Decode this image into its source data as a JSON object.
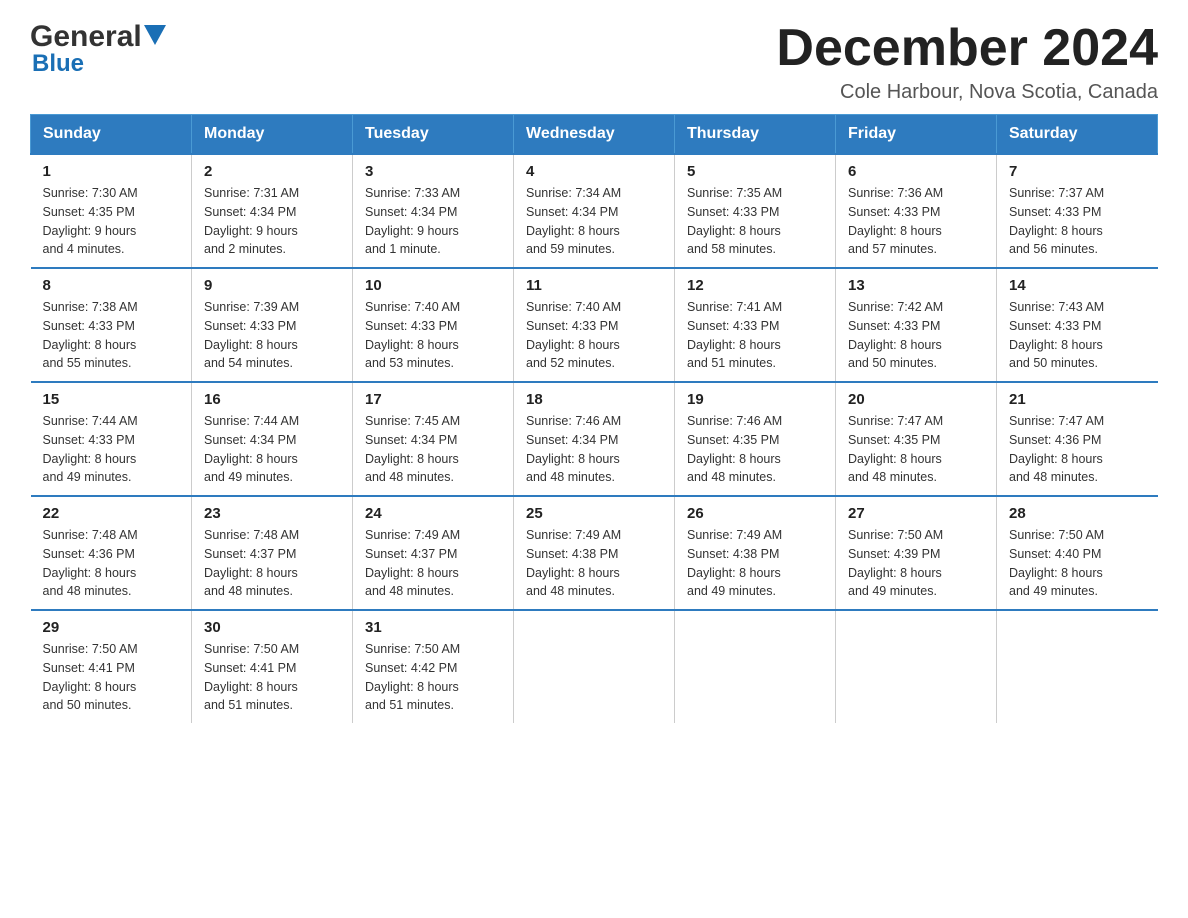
{
  "logo": {
    "general": "General",
    "blue": "Blue"
  },
  "title": {
    "month_year": "December 2024",
    "location": "Cole Harbour, Nova Scotia, Canada"
  },
  "days_of_week": [
    "Sunday",
    "Monday",
    "Tuesday",
    "Wednesday",
    "Thursday",
    "Friday",
    "Saturday"
  ],
  "weeks": [
    [
      {
        "day": "1",
        "sunrise": "7:30 AM",
        "sunset": "4:35 PM",
        "daylight": "9 hours and 4 minutes."
      },
      {
        "day": "2",
        "sunrise": "7:31 AM",
        "sunset": "4:34 PM",
        "daylight": "9 hours and 2 minutes."
      },
      {
        "day": "3",
        "sunrise": "7:33 AM",
        "sunset": "4:34 PM",
        "daylight": "9 hours and 1 minute."
      },
      {
        "day": "4",
        "sunrise": "7:34 AM",
        "sunset": "4:34 PM",
        "daylight": "8 hours and 59 minutes."
      },
      {
        "day": "5",
        "sunrise": "7:35 AM",
        "sunset": "4:33 PM",
        "daylight": "8 hours and 58 minutes."
      },
      {
        "day": "6",
        "sunrise": "7:36 AM",
        "sunset": "4:33 PM",
        "daylight": "8 hours and 57 minutes."
      },
      {
        "day": "7",
        "sunrise": "7:37 AM",
        "sunset": "4:33 PM",
        "daylight": "8 hours and 56 minutes."
      }
    ],
    [
      {
        "day": "8",
        "sunrise": "7:38 AM",
        "sunset": "4:33 PM",
        "daylight": "8 hours and 55 minutes."
      },
      {
        "day": "9",
        "sunrise": "7:39 AM",
        "sunset": "4:33 PM",
        "daylight": "8 hours and 54 minutes."
      },
      {
        "day": "10",
        "sunrise": "7:40 AM",
        "sunset": "4:33 PM",
        "daylight": "8 hours and 53 minutes."
      },
      {
        "day": "11",
        "sunrise": "7:40 AM",
        "sunset": "4:33 PM",
        "daylight": "8 hours and 52 minutes."
      },
      {
        "day": "12",
        "sunrise": "7:41 AM",
        "sunset": "4:33 PM",
        "daylight": "8 hours and 51 minutes."
      },
      {
        "day": "13",
        "sunrise": "7:42 AM",
        "sunset": "4:33 PM",
        "daylight": "8 hours and 50 minutes."
      },
      {
        "day": "14",
        "sunrise": "7:43 AM",
        "sunset": "4:33 PM",
        "daylight": "8 hours and 50 minutes."
      }
    ],
    [
      {
        "day": "15",
        "sunrise": "7:44 AM",
        "sunset": "4:33 PM",
        "daylight": "8 hours and 49 minutes."
      },
      {
        "day": "16",
        "sunrise": "7:44 AM",
        "sunset": "4:34 PM",
        "daylight": "8 hours and 49 minutes."
      },
      {
        "day": "17",
        "sunrise": "7:45 AM",
        "sunset": "4:34 PM",
        "daylight": "8 hours and 48 minutes."
      },
      {
        "day": "18",
        "sunrise": "7:46 AM",
        "sunset": "4:34 PM",
        "daylight": "8 hours and 48 minutes."
      },
      {
        "day": "19",
        "sunrise": "7:46 AM",
        "sunset": "4:35 PM",
        "daylight": "8 hours and 48 minutes."
      },
      {
        "day": "20",
        "sunrise": "7:47 AM",
        "sunset": "4:35 PM",
        "daylight": "8 hours and 48 minutes."
      },
      {
        "day": "21",
        "sunrise": "7:47 AM",
        "sunset": "4:36 PM",
        "daylight": "8 hours and 48 minutes."
      }
    ],
    [
      {
        "day": "22",
        "sunrise": "7:48 AM",
        "sunset": "4:36 PM",
        "daylight": "8 hours and 48 minutes."
      },
      {
        "day": "23",
        "sunrise": "7:48 AM",
        "sunset": "4:37 PM",
        "daylight": "8 hours and 48 minutes."
      },
      {
        "day": "24",
        "sunrise": "7:49 AM",
        "sunset": "4:37 PM",
        "daylight": "8 hours and 48 minutes."
      },
      {
        "day": "25",
        "sunrise": "7:49 AM",
        "sunset": "4:38 PM",
        "daylight": "8 hours and 48 minutes."
      },
      {
        "day": "26",
        "sunrise": "7:49 AM",
        "sunset": "4:38 PM",
        "daylight": "8 hours and 49 minutes."
      },
      {
        "day": "27",
        "sunrise": "7:50 AM",
        "sunset": "4:39 PM",
        "daylight": "8 hours and 49 minutes."
      },
      {
        "day": "28",
        "sunrise": "7:50 AM",
        "sunset": "4:40 PM",
        "daylight": "8 hours and 49 minutes."
      }
    ],
    [
      {
        "day": "29",
        "sunrise": "7:50 AM",
        "sunset": "4:41 PM",
        "daylight": "8 hours and 50 minutes."
      },
      {
        "day": "30",
        "sunrise": "7:50 AM",
        "sunset": "4:41 PM",
        "daylight": "8 hours and 51 minutes."
      },
      {
        "day": "31",
        "sunrise": "7:50 AM",
        "sunset": "4:42 PM",
        "daylight": "8 hours and 51 minutes."
      },
      null,
      null,
      null,
      null
    ]
  ],
  "labels": {
    "sunrise": "Sunrise:",
    "sunset": "Sunset:",
    "daylight": "Daylight:"
  }
}
